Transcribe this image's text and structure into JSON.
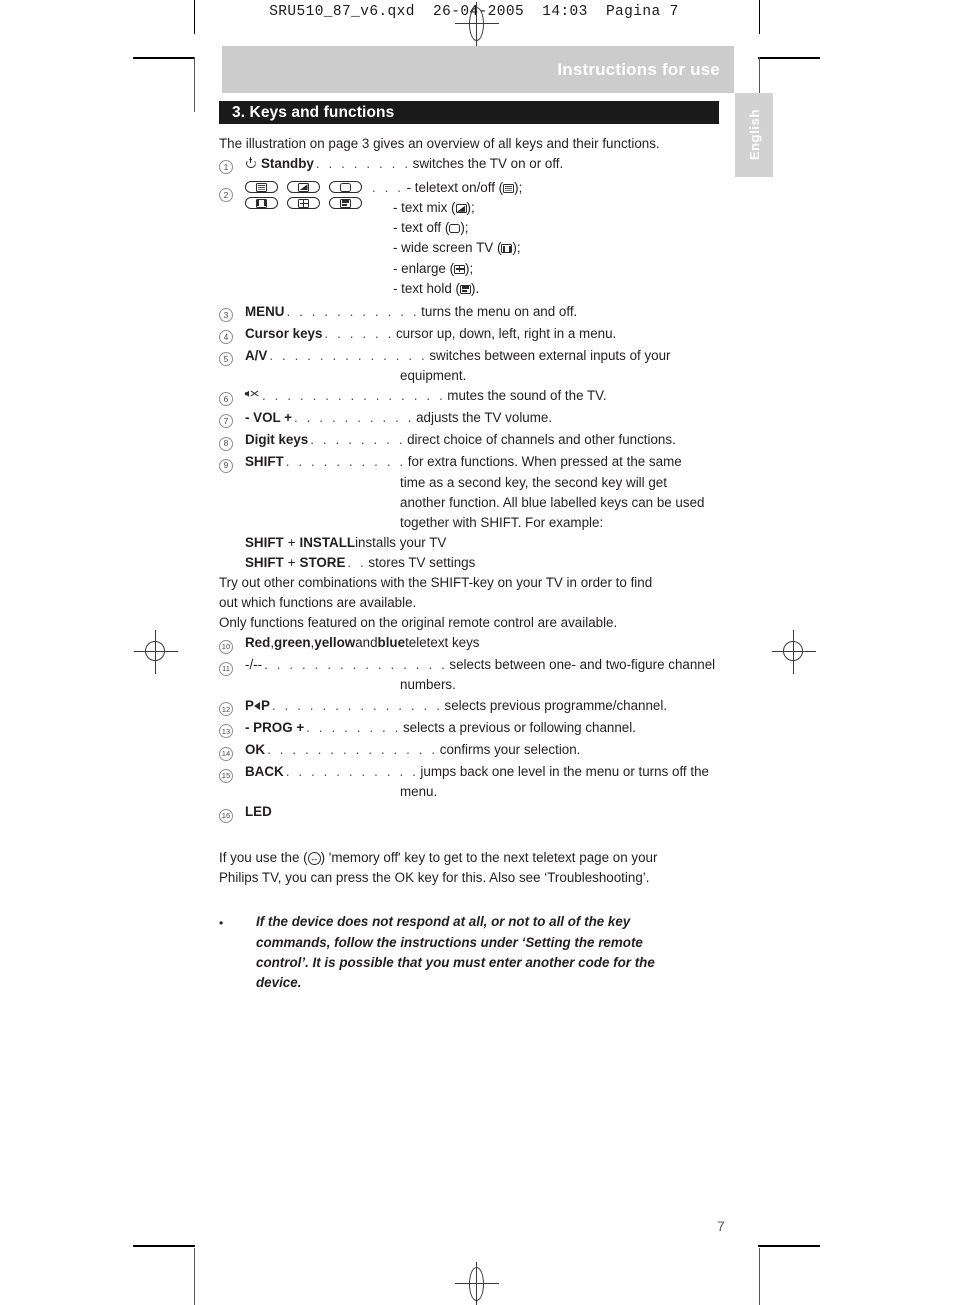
{
  "prepress": {
    "header_line": "SRU510_87_v6.qxd  26-04-2005  14:03  Pagina 7"
  },
  "banner": {
    "title": "Instructions for use"
  },
  "language_tab": {
    "label": "English"
  },
  "section": {
    "title": "3. Keys and functions"
  },
  "intro": "The illustration on page 3 gives an overview of all keys and their functions.",
  "entries": [
    {
      "number": "1",
      "icon": "power-standby-icon",
      "key": "Standby",
      "leader": ". . . . . . . .",
      "desc": "switches the TV on or off."
    },
    {
      "number": "2",
      "type": "teletext-group",
      "leader": ". . .",
      "buttons": [
        "teletext-on-off-icon",
        "text-mix-icon",
        "text-off-icon",
        "wide-screen-tv-icon",
        "enlarge-icon",
        "text-hold-icon"
      ],
      "lines": [
        {
          "text": "- teletext on/off (",
          "icon": "teletext-on-off-icon",
          "tail": ");"
        },
        {
          "text": "- text mix (",
          "icon": "text-mix-icon",
          "tail": ");"
        },
        {
          "text": "- text off (",
          "icon": "text-off-icon",
          "tail": ");"
        },
        {
          "text": "- wide screen TV (",
          "icon": "wide-screen-tv-icon",
          "tail": ");"
        },
        {
          "text": "- enlarge (",
          "icon": "enlarge-icon",
          "tail": ");"
        },
        {
          "text": "- text hold (",
          "icon": "text-hold-icon",
          "tail": ")."
        }
      ]
    },
    {
      "number": "3",
      "key": "MENU",
      "leader": ". . . . . . . . . . .",
      "desc": "turns the menu on and off."
    },
    {
      "number": "4",
      "key": "Cursor keys",
      "leader": ". . . . . .",
      "desc": "cursor up, down, left, right in a menu."
    },
    {
      "number": "5",
      "key": "A/V",
      "leader": ". . . . . . . . . . . . .",
      "desc": "switches between external inputs of your",
      "desc2": "equipment."
    },
    {
      "number": "6",
      "icon": "mute-icon",
      "key": "",
      "leader": ". . . . . . . . . . . . . . .",
      "desc": "mutes the sound of the TV."
    },
    {
      "number": "7",
      "key": "- VOL +",
      "leader": ". . . . . . . . . .",
      "desc": "adjusts the TV volume."
    },
    {
      "number": "8",
      "key": "Digit keys",
      "leader": ". . . . . . . .",
      "desc": "direct choice of channels and other functions."
    },
    {
      "number": "9",
      "key": "SHIFT",
      "leader": ". . . . . . . . . .",
      "desc": "for extra functions. When pressed at the same",
      "desc_lines": [
        "time as a second key, the second key will get",
        "another function. All blue labelled keys can be used",
        "together with SHIFT. For example:"
      ]
    }
  ],
  "shift_examples": [
    {
      "a": "SHIFT",
      "plus": "+",
      "b": "INSTALL",
      "leader": "",
      "desc": "installs your TV"
    },
    {
      "a": "SHIFT",
      "plus": "+",
      "b": "STORE",
      "leader": ". .",
      "desc": "stores TV settings"
    }
  ],
  "paragraphs_mid": [
    "Try out other combinations with the SHIFT-key on your TV in order to find",
    "out which functions are available.",
    "Only functions featured on the original remote control are available."
  ],
  "entries2": [
    {
      "number": "10",
      "type": "colors",
      "parts": [
        {
          "text": "Red",
          "bold": true
        },
        {
          "text": ", ",
          "bold": false
        },
        {
          "text": "green",
          "bold": true
        },
        {
          "text": ", ",
          "bold": false
        },
        {
          "text": "yellow",
          "bold": true
        },
        {
          "text": " and ",
          "bold": false
        },
        {
          "text": "blue",
          "bold": true
        },
        {
          "text": " teletext keys",
          "bold": false
        }
      ]
    },
    {
      "number": "11",
      "key": "-/--",
      "key_bold": false,
      "leader": ". . . . . . . . . . . . . . .",
      "desc": "selects between one- and two-figure channel",
      "desc2": "numbers."
    },
    {
      "number": "12",
      "type": "pip",
      "key_pre": "P",
      "key_post": "P",
      "leader": ". . . . . . . . . . . . . .",
      "desc": "selects previous programme/channel."
    },
    {
      "number": "13",
      "key": "- PROG +",
      "leader": ". . . . . . . .",
      "desc": "selects a previous or following channel."
    },
    {
      "number": "14",
      "key": "OK",
      "leader": ". . . . . . . . . . . . . .",
      "desc": "confirms your selection."
    },
    {
      "number": "15",
      "key": "BACK",
      "leader": ". . . . . . . . . . .",
      "desc": "jumps back one level in the menu or turns off the",
      "desc2": "menu."
    },
    {
      "number": "16",
      "key": "LED",
      "leader": "",
      "desc": ""
    }
  ],
  "memory_note": {
    "pre": "If you use the (",
    "icon": "memory-off-icon",
    "post": ") 'memory off' key to get to the next teletext page on your",
    "line2": "Philips TV, you can press the OK key for this. Also see ‘Troubleshooting’."
  },
  "warning": {
    "bullet": "•",
    "lines": [
      "If the device does not respond at all, or not to all of the key",
      "commands, follow the instructions under ‘Setting the remote",
      "control’. It is possible that you must enter another code for the",
      "device."
    ]
  },
  "page_number": "7",
  "colors": {
    "banner_bg": "#cccccc",
    "section_bg": "#1a1a1a",
    "tab_bg": "#d2d2d2",
    "text": "#231f20"
  }
}
